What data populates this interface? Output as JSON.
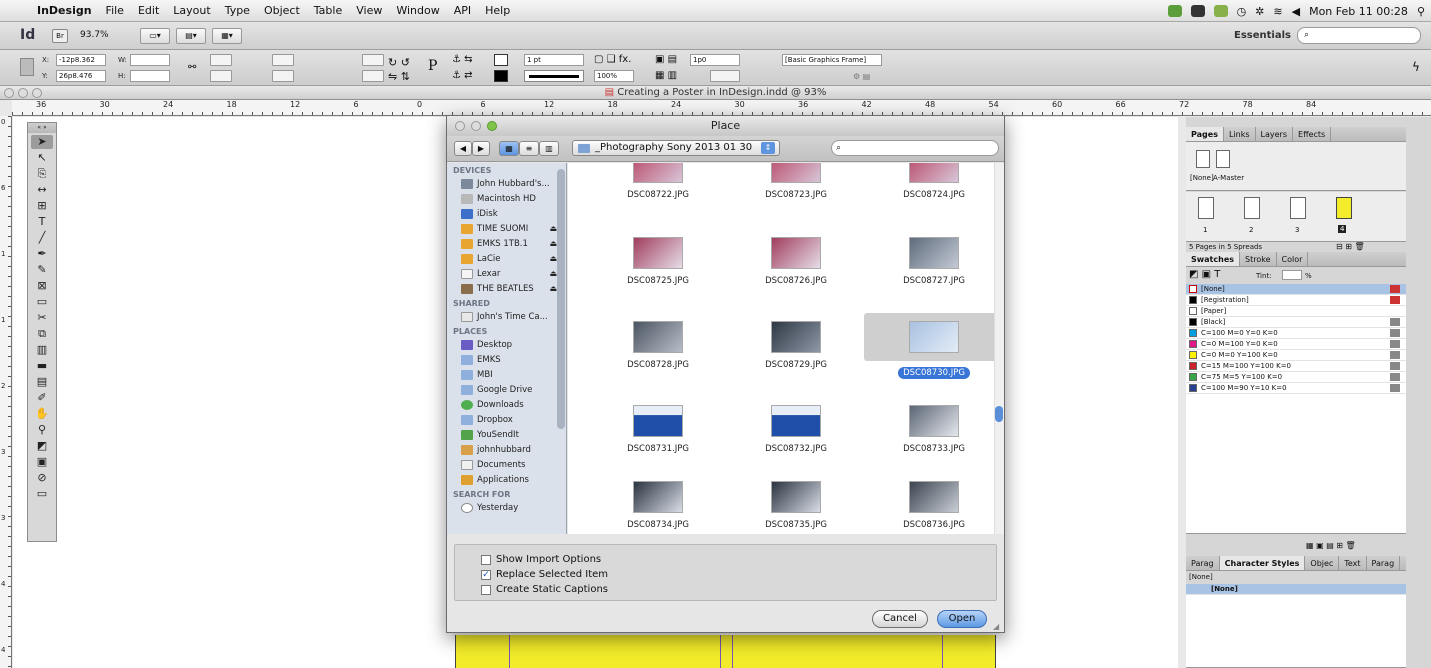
{
  "menubar": {
    "app": "InDesign",
    "items": [
      "File",
      "Edit",
      "Layout",
      "Type",
      "Object",
      "Table",
      "View",
      "Window",
      "API",
      "Help"
    ],
    "clock": "Mon Feb 11  00:28"
  },
  "appbar": {
    "logo": "Id",
    "bridge": "Br",
    "zoom": "93.7%",
    "workspace": "Essentials",
    "search_glyph": "⌕"
  },
  "control": {
    "x_label": "X:",
    "x_value": "-12p8.362",
    "y_label": "Y:",
    "y_value": "26p8.476",
    "w_label": "W:",
    "h_label": "H:",
    "stroke": "1 pt",
    "scale": "100%",
    "gap": "1p0",
    "style": "[Basic Graphics Frame]"
  },
  "document": {
    "title": "Creating a Poster in InDesign.indd @ 93%"
  },
  "ruler": {
    "h_ticks": [
      "36",
      "30",
      "24",
      "18",
      "12",
      "6",
      "0",
      "6",
      "12",
      "18",
      "24",
      "30",
      "36",
      "42",
      "48",
      "54",
      "60",
      "66",
      "72",
      "78",
      "84"
    ],
    "v_ticks": [
      "0",
      "6",
      "1",
      "1",
      "2",
      "3",
      "3",
      "4",
      "4"
    ]
  },
  "dialog": {
    "title": "Place",
    "folder": "_Photography Sony 2013 01 30",
    "search_placeholder": "",
    "sidebar": {
      "devices_head": "DEVICES",
      "devices": [
        "John Hubbard's...",
        "Macintosh HD",
        "iDisk",
        "TIME SUOMI",
        "EMKS 1TB.1",
        "LaCie",
        "Lexar",
        "THE BEATLES"
      ],
      "shared_head": "SHARED",
      "shared": [
        "John's Time Ca..."
      ],
      "places_head": "PLACES",
      "places": [
        "Desktop",
        "EMKS",
        "MBI",
        "Google Drive",
        "Downloads",
        "Dropbox",
        "YouSendIt",
        "johnhubbard",
        "Documents",
        "Applications"
      ],
      "search_head": "SEARCH FOR",
      "search": [
        "Yesterday"
      ]
    },
    "files": [
      "DSC08722.JPG",
      "DSC08723.JPG",
      "DSC08724.JPG",
      "DSC08725.JPG",
      "DSC08726.JPG",
      "DSC08727.JPG",
      "DSC08728.JPG",
      "DSC08729.JPG",
      "DSC08730.JPG",
      "DSC08731.JPG",
      "DSC08732.JPG",
      "DSC08733.JPG",
      "DSC08734.JPG",
      "DSC08735.JPG",
      "DSC08736.JPG"
    ],
    "selected_file": "DSC08730.JPG",
    "options": {
      "show_import": "Show Import Options",
      "replace_selected": "Replace Selected Item",
      "static_captions": "Create Static Captions"
    },
    "cancel": "Cancel",
    "open": "Open"
  },
  "panels": {
    "pages_tabs": [
      "Pages",
      "Links",
      "Layers",
      "Effects"
    ],
    "none_label": "[None]",
    "master_label": "A-Master",
    "page_numbers": [
      "1",
      "2",
      "3",
      "4"
    ],
    "pages_status": "5 Pages in 5 Spreads",
    "swatches_tabs": [
      "Swatches",
      "Stroke",
      "Color"
    ],
    "tint_label": "Tint:",
    "tint_unit": "%",
    "swatches": [
      {
        "name": "[None]",
        "color": "#ffffff"
      },
      {
        "name": "[Registration]",
        "color": "#000000"
      },
      {
        "name": "[Paper]",
        "color": "#ffffff"
      },
      {
        "name": "[Black]",
        "color": "#000000"
      },
      {
        "name": "C=100 M=0 Y=0 K=0",
        "color": "#00a0e0"
      },
      {
        "name": "C=0 M=100 Y=0 K=0",
        "color": "#e0168c"
      },
      {
        "name": "C=0 M=0 Y=100 K=0",
        "color": "#fff200"
      },
      {
        "name": "C=15 M=100 Y=100 K=0",
        "color": "#cc2229"
      },
      {
        "name": "C=75 M=5 Y=100 K=0",
        "color": "#3aa64a"
      },
      {
        "name": "C=100 M=90 Y=10 K=0",
        "color": "#283f8f"
      }
    ],
    "style_tabs": [
      "Parag",
      "Character Styles",
      "Objec",
      "Text",
      "Parag"
    ],
    "style_none": "[None]",
    "style_selected": "[None]"
  },
  "colors": {
    "selection": "#3875d7",
    "page_yellow": "#f3ec2a"
  }
}
